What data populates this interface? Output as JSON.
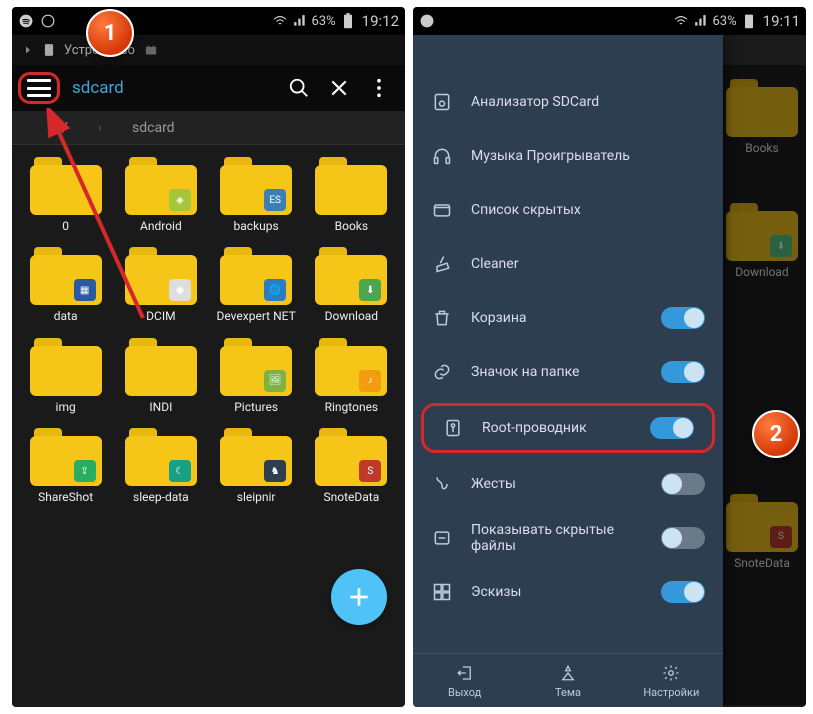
{
  "status": {
    "battery": "63%",
    "time_left": "19:12",
    "time_right": "19:11"
  },
  "tabstrip": {
    "label": "Устройство"
  },
  "toolbar": {
    "path": "sdcard"
  },
  "breadcrumb": {
    "root": "/",
    "current": "sdcard"
  },
  "folders": [
    {
      "name": "0",
      "badge": ""
    },
    {
      "name": "Android",
      "badge": "android"
    },
    {
      "name": "backups",
      "badge": "es"
    },
    {
      "name": "Books",
      "badge": ""
    },
    {
      "name": "data",
      "badge": "app"
    },
    {
      "name": "DCIM",
      "badge": "camera"
    },
    {
      "name": "Devexpert NET",
      "badge": "globe"
    },
    {
      "name": "Download",
      "badge": "download"
    },
    {
      "name": "img",
      "badge": ""
    },
    {
      "name": "INDI",
      "badge": ""
    },
    {
      "name": "Pictures",
      "badge": "pic"
    },
    {
      "name": "Ringtones",
      "badge": "ring"
    },
    {
      "name": "ShareShot",
      "badge": "share"
    },
    {
      "name": "sleep-data",
      "badge": "sleep"
    },
    {
      "name": "sleipnir",
      "badge": "horse"
    },
    {
      "name": "SnoteData",
      "badge": "snote"
    }
  ],
  "right_folders": [
    {
      "name": "Books"
    },
    {
      "name": "Download"
    },
    {
      "name": "SnoteData"
    }
  ],
  "drawer": {
    "items": [
      {
        "label": "Анализатор SDCard",
        "icon": "sdcard",
        "toggle": null
      },
      {
        "label": "Музыка Проигрыватель",
        "icon": "headphones",
        "toggle": null
      },
      {
        "label": "Список скрытых",
        "icon": "folder-hidden",
        "toggle": null
      },
      {
        "label": "Cleaner",
        "icon": "broom",
        "toggle": null
      },
      {
        "label": "Корзина",
        "icon": "trash",
        "toggle": true
      },
      {
        "label": "Значок на папке",
        "icon": "link",
        "toggle": true
      },
      {
        "label": "Root-проводник",
        "icon": "root",
        "toggle": true
      },
      {
        "label": "Жесты",
        "icon": "gesture",
        "toggle": false
      },
      {
        "label": "Показывать скрытые файлы",
        "icon": "show-hidden",
        "toggle": false
      },
      {
        "label": "Эскизы",
        "icon": "thumbnails",
        "toggle": true
      }
    ],
    "bottom": [
      {
        "label": "Выход",
        "icon": "exit"
      },
      {
        "label": "Тема",
        "icon": "theme"
      },
      {
        "label": "Настройки",
        "icon": "settings"
      }
    ]
  },
  "markers": {
    "one": "1",
    "two": "2"
  },
  "colors": {
    "accent": "#3fa7d6",
    "highlight": "#d62828",
    "drawer": "#2c3e50",
    "folder": "#f5c518"
  }
}
